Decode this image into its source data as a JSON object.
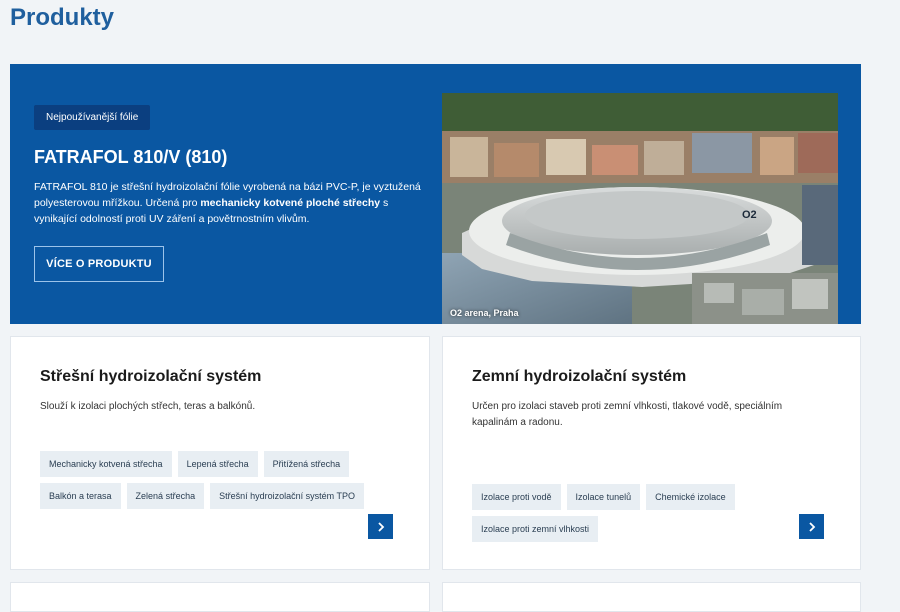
{
  "page": {
    "title": "Produkty"
  },
  "hero": {
    "badge": "Nejpoužívanější fólie",
    "title": "FATRAFOL 810/V (810)",
    "desc_part1": "FATRAFOL 810 je střešní hydroizolační fólie vyrobená na bázi PVC-P, je vyztužená polyesterovou mřížkou. Určená pro ",
    "desc_bold": "mechanicky kotvené ploché střechy",
    "desc_part2": " s vynikající odolností proti UV záření a povětrnostním vlivům.",
    "button_label": "VÍCE O PRODUKTU",
    "image_caption": "O2 arena, Praha",
    "image_logo": "O2"
  },
  "cards": [
    {
      "title": "Střešní hydroizolační systém",
      "desc": "Slouží k izolaci plochých střech, teras a balkónů.",
      "tags": [
        "Mechanicky kotvená střecha",
        "Lepená střecha",
        "Přitížená střecha",
        "Balkón a terasa",
        "Zelená střecha",
        "Střešní hydroizolační systém TPO"
      ]
    },
    {
      "title": "Zemní hydroizolační systém",
      "desc": "Určen pro izolaci staveb proti zemní vlhkosti, tlakové vodě, speciálním kapalinám a radonu.",
      "tags": [
        "Izolace proti vodě",
        "Izolace tunelů",
        "Chemické izolace",
        "Izolace proti zemní vlhkosti"
      ]
    }
  ],
  "colors": {
    "brand_blue": "#0a57a2",
    "title_blue": "#1f5f9e",
    "badge_blue": "#0b3f80",
    "tag_bg": "#e8eef3"
  },
  "icons": {
    "card_arrow": "chevron-right-icon"
  }
}
